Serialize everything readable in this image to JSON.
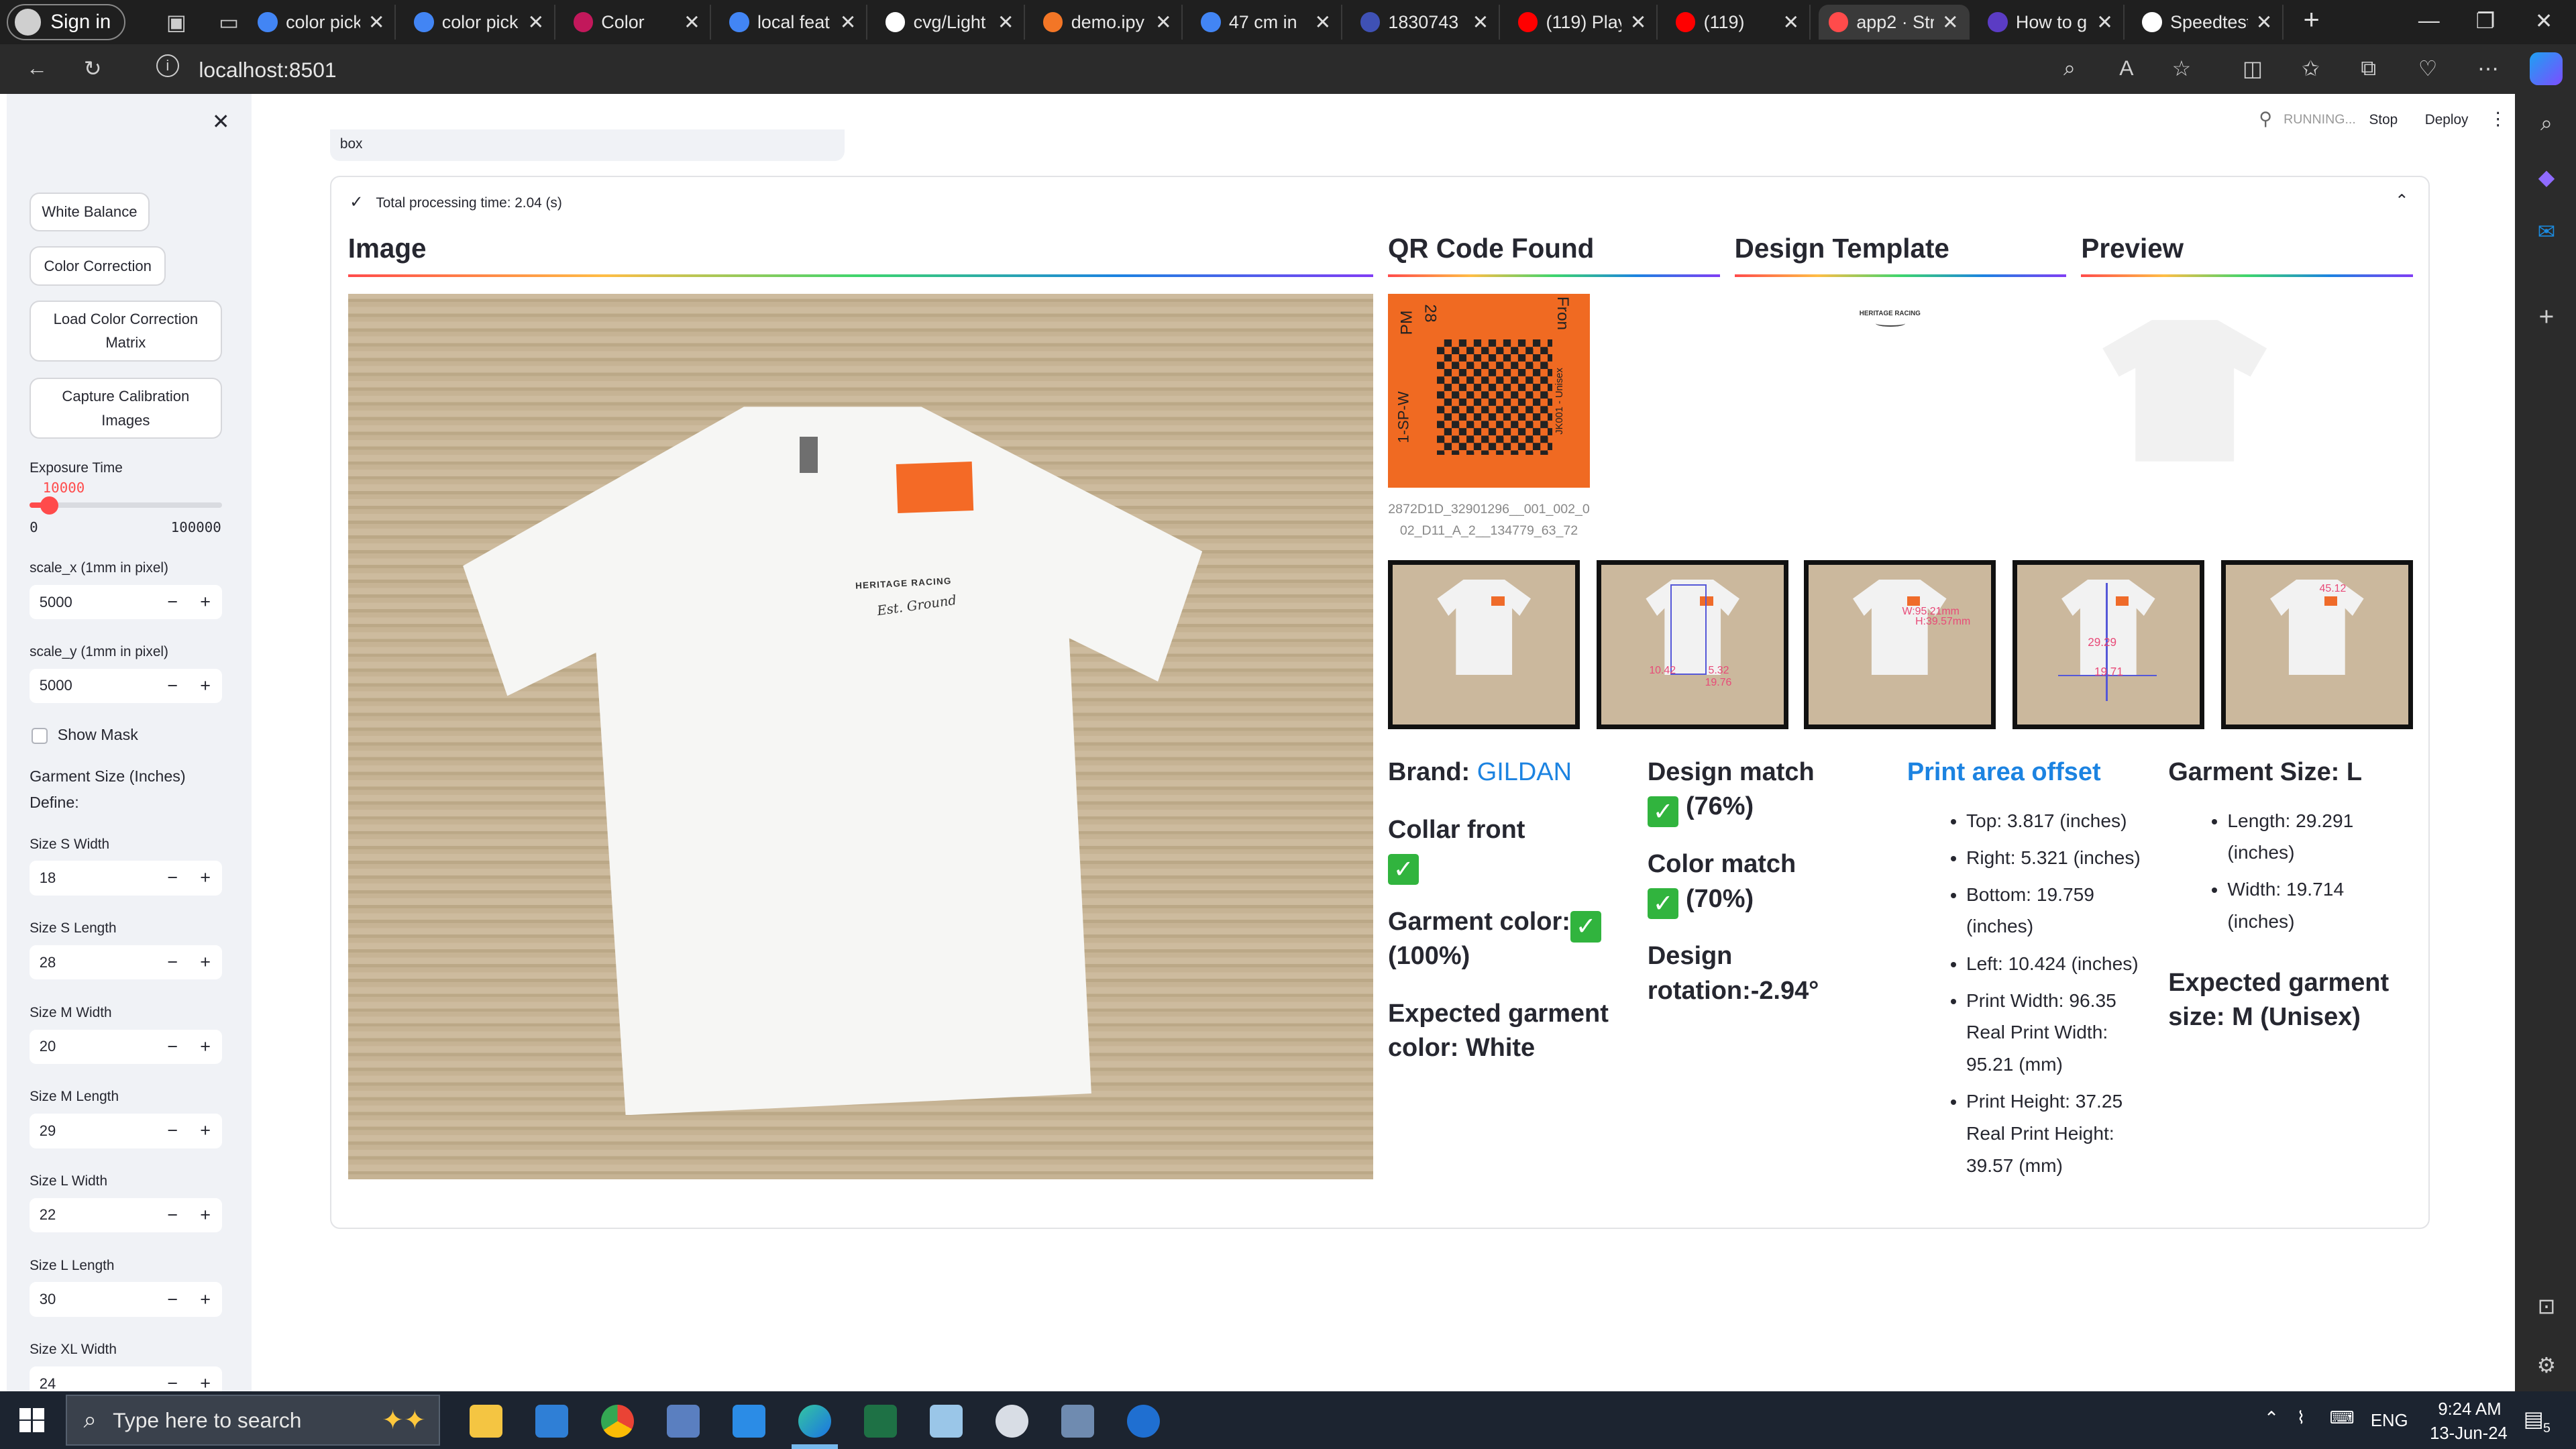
{
  "browser": {
    "signin": "Sign in",
    "tabs": [
      {
        "label": "color pick",
        "fav": "#4285f4"
      },
      {
        "label": "color pick",
        "fav": "#4285f4"
      },
      {
        "label": "Color",
        "fav": "#c2185b"
      },
      {
        "label": "local feat",
        "fav": "#4285f4"
      },
      {
        "label": "cvg/Light",
        "fav": "#ffffff"
      },
      {
        "label": "demo.ipy",
        "fav": "#f37626"
      },
      {
        "label": "47 cm in",
        "fav": "#4285f4"
      },
      {
        "label": "1830743",
        "fav": "#3f51b5"
      },
      {
        "label": "(119) Play",
        "fav": "#ff0000"
      },
      {
        "label": "(119)",
        "fav": "#ff0000"
      },
      {
        "label": "app2 · Str",
        "fav": "#ff4b4b"
      },
      {
        "label": "How to g",
        "fav": "#5b3cc4"
      },
      {
        "label": "Speedtest",
        "fav": "#ffffff"
      }
    ],
    "url": "localhost:8501"
  },
  "sidebar": {
    "white_balance": "White Balance",
    "color_correction": "Color Correction",
    "load_ccm": "Load Color Correction Matrix",
    "capture_calibration": "Capture Calibration Images",
    "exposure_label": "Exposure Time",
    "exposure_value": "10000",
    "exposure_min": "0",
    "exposure_max": "100000",
    "exposure_fraction": 0.1,
    "scale_x_label": "scale_x (1mm in pixel)",
    "scale_x_value": "5000",
    "scale_y_label": "scale_y (1mm in pixel)",
    "scale_y_value": "5000",
    "show_mask": "Show Mask",
    "garment_size_label": "Garment Size (Inches)",
    "define_label": "Define:",
    "sizes": [
      {
        "label": "Size S Width",
        "value": "18"
      },
      {
        "label": "Size S Length",
        "value": "28"
      },
      {
        "label": "Size M Width",
        "value": "20"
      },
      {
        "label": "Size M Length",
        "value": "29"
      },
      {
        "label": "Size L Width",
        "value": "22"
      },
      {
        "label": "Size L Length",
        "value": "30"
      },
      {
        "label": "Size XL Width",
        "value": "24"
      }
    ]
  },
  "header": {
    "running": "RUNNING...",
    "stop": "Stop",
    "deploy": "Deploy"
  },
  "main": {
    "box_label": "box",
    "processing_time": "Total processing time: 2.04 (s)",
    "image_title": "Image",
    "qr_title": "QR Code Found",
    "design_title": "Design Template",
    "preview_title": "Preview",
    "qr_caption": "2872D1D_32901296__001_002_002_D11_A_2__134779_63_72",
    "qr_text_fragments": [
      "PM",
      "28",
      "Fron",
      "1-SP-W",
      "JK001 - Unisex"
    ],
    "design_text": "HERITAGE RACING",
    "shirt_print_text": "HERITAGE RACING",
    "shirt_script_text": "Est. Ground",
    "thumb_annotations": [
      "10.42",
      "5.32",
      "19.76",
      "W:95.21mm",
      "H:39.57mm",
      "29.29",
      "19.71",
      "45.12"
    ],
    "brand_label": "Brand: ",
    "brand_value": "GILDAN",
    "collar_front": "Collar front",
    "garment_color_label": "Garment color:",
    "garment_color_pct": "(100%)",
    "expected_color": "Expected garment color: White",
    "design_match": "Design match",
    "design_match_pct": "(76%)",
    "color_match": "Color match",
    "color_match_pct": "(70%)",
    "design_rotation": "Design rotation:-2.94°",
    "print_area_title": "Print area offset",
    "print_area_items": [
      "Top: 3.817 (inches)",
      "Right: 5.321 (inches)",
      "Bottom: 19.759 (inches)",
      "Left: 10.424 (inches)",
      "Print Width: 96.35 Real Print Width: 95.21 (mm)",
      "Print Height: 37.25 Real Print Height: 39.57 (mm)"
    ],
    "garment_size_title": "Garment Size: L",
    "garment_size_items": [
      "Length: 29.291 (inches)",
      "Width: 19.714 (inches)"
    ],
    "expected_size": "Expected garment size: M (Unisex)"
  },
  "taskbar": {
    "search_placeholder": "Type here to search",
    "time": "9:24 AM",
    "date": "13-Jun-24",
    "lang": "ENG",
    "notif_count": "5"
  },
  "colors": {
    "accent": "#ff4b4b",
    "brand_link": "#1c83e1",
    "check": "#31b43e",
    "sidebar_bg": "#f0f2f6"
  }
}
